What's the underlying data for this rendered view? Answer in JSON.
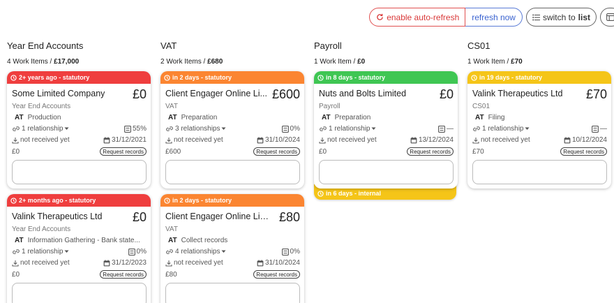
{
  "toolbar": {
    "auto_refresh": "enable auto-refresh",
    "refresh_now": "refresh now",
    "switch_prefix": "switch to",
    "switch_bold": "list"
  },
  "columns": [
    {
      "title": "Year End Accounts",
      "count": "4 Work Items",
      "sep": "/",
      "total": "£17,000"
    },
    {
      "title": "VAT",
      "count": "2 Work Items",
      "sep": "/",
      "total": "£680"
    },
    {
      "title": "Payroll",
      "count": "1 Work Item",
      "sep": "/",
      "total": "£0"
    },
    {
      "title": "CS01",
      "count": "1 Work Item",
      "sep": "/",
      "total": "£70"
    }
  ],
  "cards": [
    {
      "banner": "2+ years ago - statutory",
      "banner_color": "#ef3e3e",
      "client": "Some Limited Company",
      "amount": "£0",
      "service": "Year End Accounts",
      "initials": "AT",
      "stage": "Production",
      "relationships": "1 relationship",
      "progress": "55%",
      "records": "not received yet",
      "due": "31/12/2021",
      "fee": "£0",
      "request": "Request records"
    },
    {
      "banner": "in 2 days - statutory",
      "banner_color": "#fb8531",
      "client": "Client Engager Online Li...",
      "amount": "£600",
      "service": "VAT",
      "initials": "AT",
      "stage": "Preparation",
      "relationships": "3 relationships",
      "progress": "0%",
      "records": "not received yet",
      "due": "31/10/2024",
      "fee": "£600",
      "request": "Request records"
    },
    {
      "banner": "in 8 days - statutory",
      "banner_color": "#3fc653",
      "client": "Nuts and Bolts Limited",
      "amount": "£0",
      "service": "Payroll",
      "initials": "AT",
      "stage": "Preparation",
      "relationships": "1 relationship",
      "progress": "—",
      "records": "not received yet",
      "due": "13/12/2024",
      "fee": "£0",
      "request": "Request records"
    },
    {
      "banner": "in 19 days - statutory",
      "banner_color": "#f5c518",
      "client": "Valink Therapeutics Ltd",
      "amount": "£70",
      "service": "CS01",
      "initials": "AT",
      "stage": "Filing",
      "relationships": "1 relationship",
      "progress": "—",
      "records": "not received yet",
      "due": "10/12/2024",
      "fee": "£70",
      "request": "Request records"
    },
    {
      "banner": "2+ months ago - statutory",
      "banner_color": "#ef3e3e",
      "client": "Valink Therapeutics Ltd",
      "amount": "£0",
      "service": "Year End Accounts",
      "initials": "AT",
      "stage": "Information Gathering - Bank state...",
      "relationships": "1 relationship",
      "progress": "0%",
      "records": "not received yet",
      "due": "31/12/2023",
      "fee": "£0",
      "request": "Request records"
    },
    {
      "banner": "in 2 days - statutory",
      "banner_color": "#fb8531",
      "client": "Client Engager Online Limit...",
      "amount": "£80",
      "service": "VAT",
      "initials": "AT",
      "stage": "Collect records",
      "relationships": "4 relationships",
      "progress": "0%",
      "records": "not received yet",
      "due": "31/10/2024",
      "fee": "£80",
      "request": "Request records"
    }
  ],
  "payroll_extra_banner": "in 6 days - internal",
  "icons": {
    "auto_refresh": "refresh-icon",
    "switch": "list-icon",
    "board": "board-icon",
    "banner": "clock-icon",
    "relationships": "link-icon",
    "progress": "checklist-icon",
    "records": "download-icon",
    "due": "calendar-icon"
  }
}
